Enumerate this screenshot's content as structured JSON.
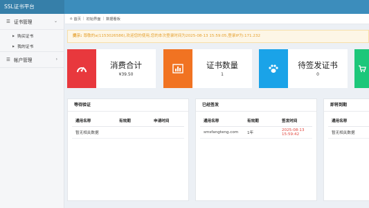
{
  "app": {
    "title": "SSL证书平台"
  },
  "sidebar": {
    "groups": [
      {
        "label": "证书管理",
        "expanded": true,
        "items": [
          {
            "label": "购买证书"
          },
          {
            "label": "我的证书"
          }
        ]
      },
      {
        "label": "帐户管理",
        "expanded": false,
        "items": []
      }
    ]
  },
  "breadcrumb": {
    "items": [
      "首页",
      "初始界面",
      "数据看板"
    ]
  },
  "notice": {
    "label": "提示:",
    "text": "尊敬的a(1153026586),欢迎您的使用,您的本次登录时间为2025-08-13 15:59:05,登录IP为:171.232"
  },
  "stats": [
    {
      "title": "消费合计",
      "value": "¥39.50",
      "color": "#e8383d",
      "icon": "gauge-icon"
    },
    {
      "title": "证书数量",
      "value": "1",
      "color": "#f17322",
      "icon": "bar-chart-icon"
    },
    {
      "title": "待签发证书",
      "value": "0",
      "color": "#1aa3e8",
      "icon": "paw-icon"
    },
    {
      "title": "",
      "value": "",
      "color": "#1cc77a",
      "icon": "cart-icon"
    }
  ],
  "panels": {
    "pending": {
      "title": "等待验证",
      "columns": [
        "通用名称",
        "有效期",
        "申请时间"
      ],
      "empty_text": "暂无相关数据"
    },
    "issued": {
      "title": "已经签发",
      "columns": [
        "通用名称",
        "有效期",
        "签发时间"
      ],
      "rows": [
        {
          "name": "smsfangteng.com",
          "validity": "1年",
          "time": "2025-08-13 15:59:42"
        }
      ]
    },
    "expiring": {
      "title": "即将到期",
      "columns": [
        "通用名称"
      ],
      "empty_text": "暂无相关数据"
    }
  }
}
